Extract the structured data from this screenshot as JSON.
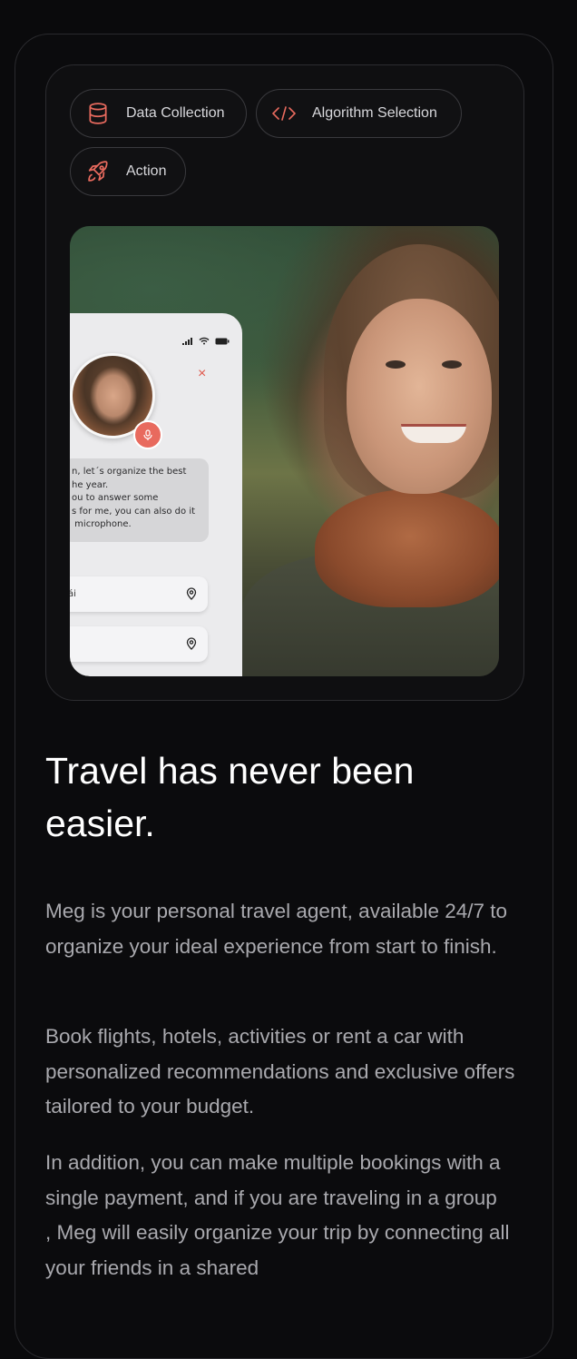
{
  "steps": [
    {
      "label": "Data Collection",
      "icon": "database-icon"
    },
    {
      "label": "Algorithm Selection",
      "icon": "code-icon"
    },
    {
      "label": "Action",
      "icon": "rocket-icon"
    }
  ],
  "phone": {
    "close_symbol": "×",
    "chat_bubble": "n, let´s organize the best\nhe year.\nou to answer some\ns for me, you can also do it\n microphone.",
    "fields": [
      "ái",
      ""
    ]
  },
  "content": {
    "headline": "Travel has never been easier.",
    "paragraphs": [
      "Meg is your personal travel agent, available 24/7 to organize your ideal experience from start to finish.",
      "Book flights, hotels, activities or rent a car with personalized recommendations and exclusive offers tailored to your budget.",
      "In addition, you can make multiple bookings with a single payment, and if you are traveling in a group\n, Meg will easily organize your trip by connecting all your friends in a shared"
    ]
  },
  "colors": {
    "accent": "#e86a5e",
    "background": "#0a0a0c",
    "body_text": "#a9a9ae"
  }
}
